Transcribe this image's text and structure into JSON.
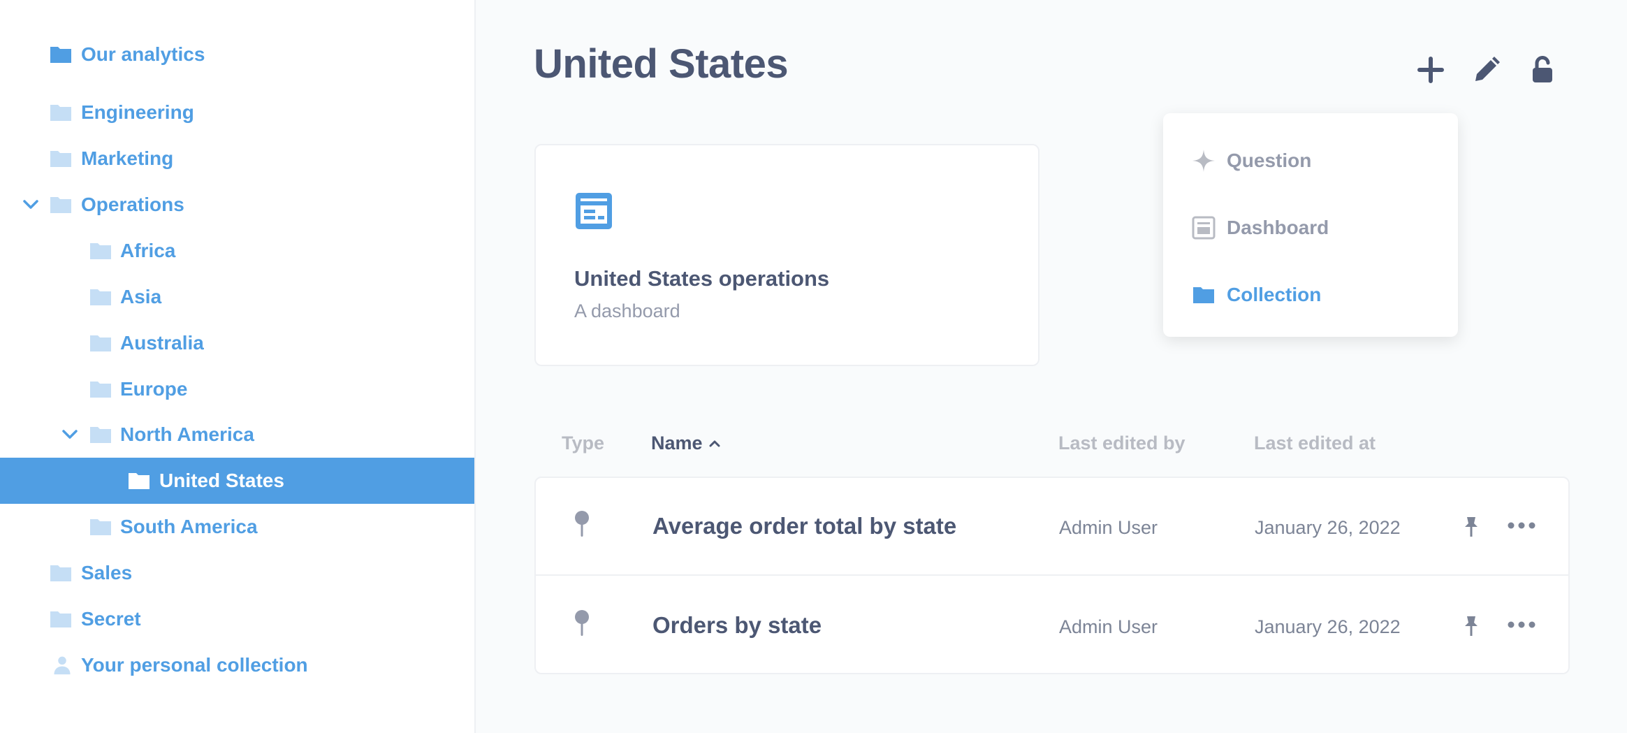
{
  "colors": {
    "brand": "#509ee3",
    "text_dark": "#4c5773",
    "text_medium": "#949aab",
    "text_light": "#b8bbc3",
    "folder_light": "#c5def5",
    "active_bg": "#509ee3"
  },
  "sidebar": {
    "items": [
      {
        "label": "Our analytics",
        "icon": "folder-icon"
      },
      {
        "label": "Engineering",
        "icon": "folder-icon"
      },
      {
        "label": "Marketing",
        "icon": "folder-icon"
      },
      {
        "label": "Operations",
        "icon": "folder-icon",
        "expanded": true
      },
      {
        "label": "Africa",
        "icon": "folder-icon"
      },
      {
        "label": "Asia",
        "icon": "folder-icon"
      },
      {
        "label": "Australia",
        "icon": "folder-icon"
      },
      {
        "label": "Europe",
        "icon": "folder-icon"
      },
      {
        "label": "North America",
        "icon": "folder-icon",
        "expanded": true
      },
      {
        "label": "United States",
        "icon": "folder-icon",
        "selected": true
      },
      {
        "label": "South America",
        "icon": "folder-icon"
      },
      {
        "label": "Sales",
        "icon": "folder-icon"
      },
      {
        "label": "Secret",
        "icon": "folder-icon"
      },
      {
        "label": "Your personal collection",
        "icon": "person-icon"
      }
    ]
  },
  "header": {
    "title": "United States",
    "actions": [
      {
        "icon": "plus-icon"
      },
      {
        "icon": "pencil-icon"
      },
      {
        "icon": "unlock-icon"
      }
    ]
  },
  "pinned": {
    "title": "United States operations",
    "subtitle": "A dashboard",
    "icon": "dashboard-icon"
  },
  "new_menu": {
    "items": [
      {
        "label": "Question",
        "icon": "sparkle-icon"
      },
      {
        "label": "Dashboard",
        "icon": "dashboard-icon"
      },
      {
        "label": "Collection",
        "icon": "folder-icon"
      }
    ]
  },
  "table": {
    "columns": [
      "Type",
      "Name",
      "Last edited by",
      "Last edited at"
    ],
    "sorted_column": "Name",
    "sort_direction": "ascending",
    "rows": [
      {
        "type_icon": "pin-map-icon",
        "name": "Average order total by state",
        "editor": "Admin User",
        "date": "January 26, 2022"
      },
      {
        "type_icon": "pin-map-icon",
        "name": "Orders by state",
        "editor": "Admin User",
        "date": "January 26, 2022"
      }
    ]
  }
}
